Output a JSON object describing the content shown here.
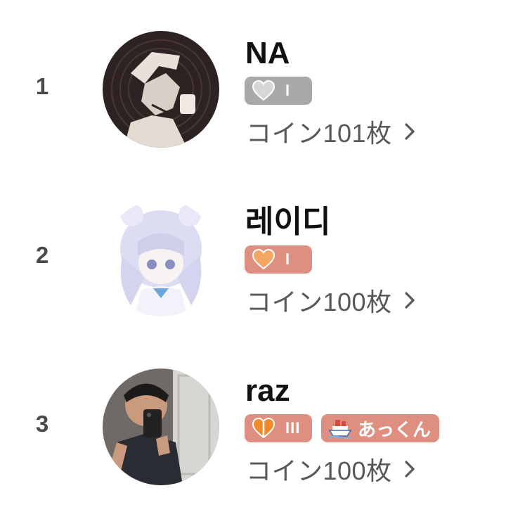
{
  "ranking": [
    {
      "rank": "1",
      "name": "NA",
      "level_badge": {
        "text": "I",
        "color": "#a9a9a9",
        "heart_icon": "heart-gray-icon"
      },
      "extra_badges": [],
      "coins": "コイン101枚"
    },
    {
      "rank": "2",
      "name": "레이디",
      "level_badge": {
        "text": "I",
        "color": "#df8f80",
        "heart_icon": "heart-orange-icon"
      },
      "extra_badges": [],
      "coins": "コイン100枚"
    },
    {
      "rank": "3",
      "name": "raz",
      "level_badge": {
        "text": "III",
        "color": "#df8f80",
        "heart_icon": "heart-split-icon"
      },
      "extra_badges": [
        {
          "icon": "ship-icon",
          "text": "あっくん",
          "color": "#df8f80"
        }
      ],
      "coins": "コイン100枚"
    }
  ],
  "colors": {
    "rank_text": "#4a4a4a",
    "coin_text": "#585858",
    "badge_gray": "#a9a9a9",
    "badge_salmon": "#df8f80"
  }
}
